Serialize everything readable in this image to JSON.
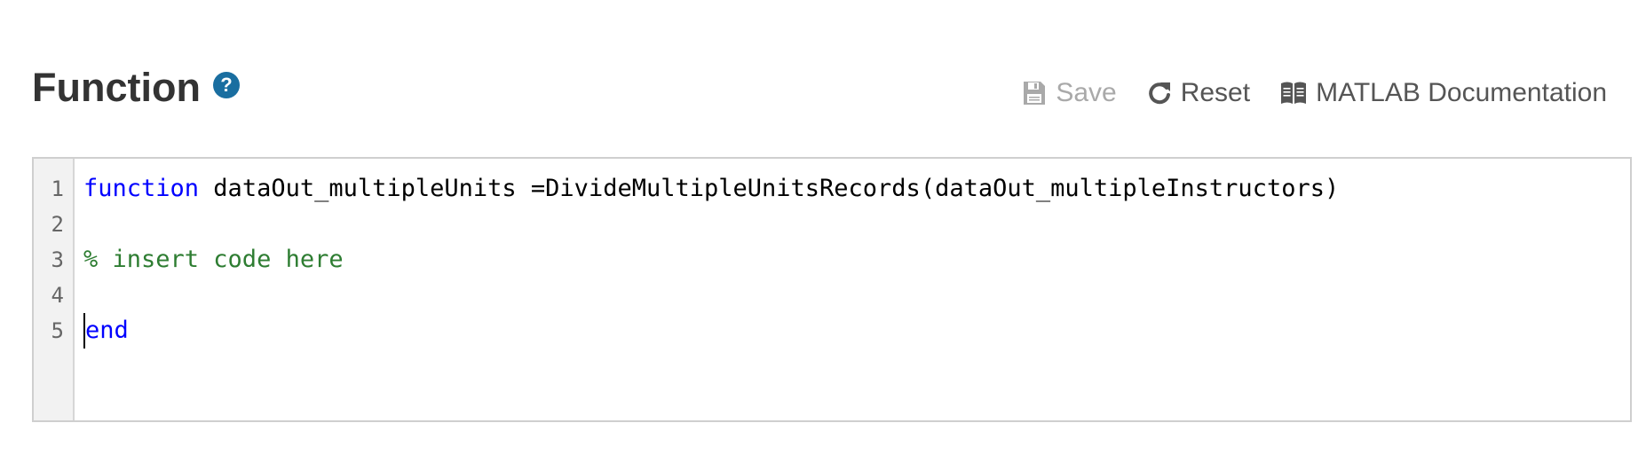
{
  "header": {
    "title": "Function",
    "help_icon": "?"
  },
  "toolbar": {
    "save_label": "Save",
    "reset_label": "Reset",
    "doc_label": "MATLAB Documentation",
    "icons": {
      "save": "floppy-disk-icon",
      "reset": "refresh-icon",
      "doc": "book-icon"
    },
    "colors": {
      "save_disabled": "#a9a9a9",
      "enabled": "#555555"
    }
  },
  "editor": {
    "line_numbers": [
      "1",
      "2",
      "3",
      "4",
      "5"
    ],
    "lines": {
      "l1_keyword": "function",
      "l1_rest": " dataOut_multipleUnits =DivideMultipleUnitsRecords(dataOut_multipleInstructors)",
      "l2": "",
      "l3_comment": "% insert code here",
      "l4": "",
      "l5_keyword": "end"
    },
    "colors": {
      "keyword": "#0000ff",
      "comment": "#2e7d32",
      "gutter_bg": "#f2f2f2"
    }
  }
}
